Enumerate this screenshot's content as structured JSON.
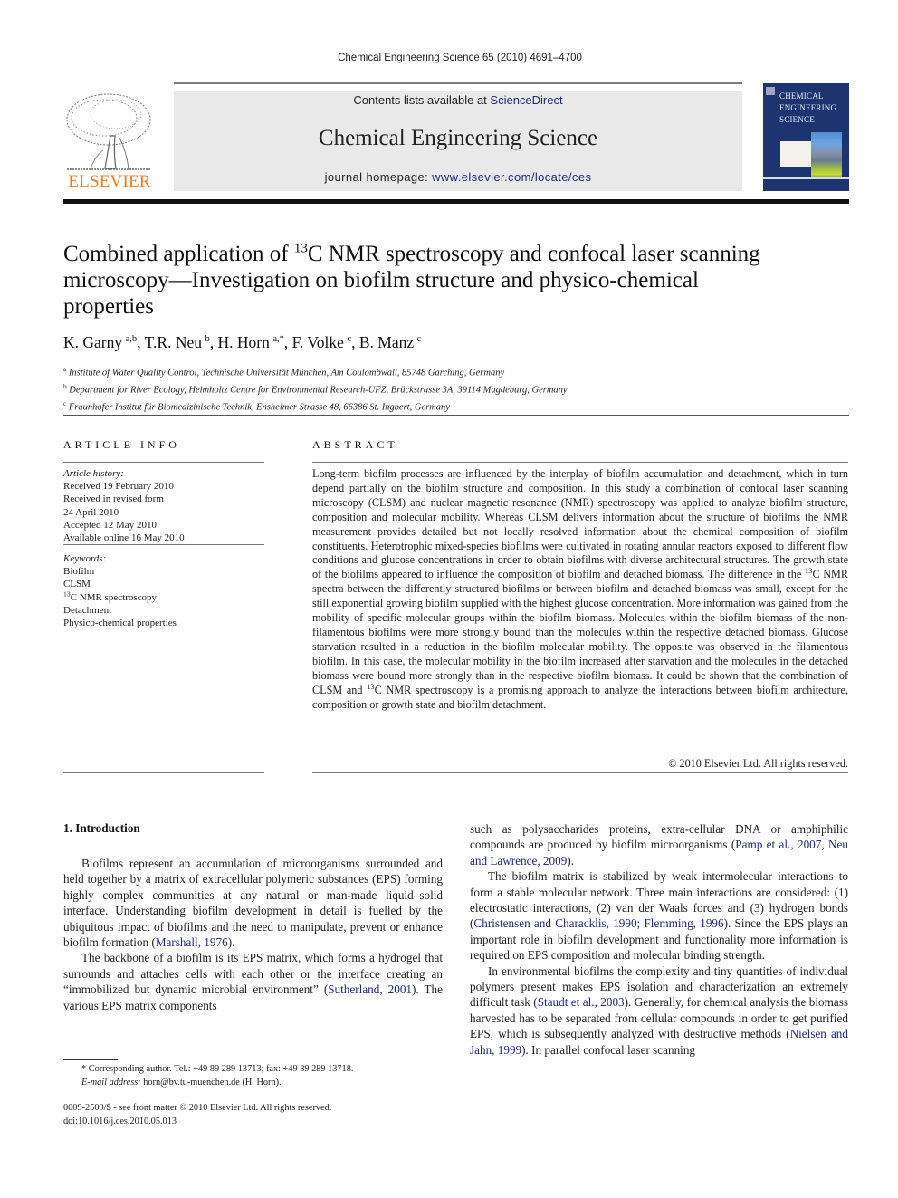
{
  "running_head": "Chemical Engineering Science 65 (2010) 4691–4700",
  "masthead": {
    "publisher_logo_text": "ELSEVIER",
    "contents_prefix": "Contents lists available at ",
    "contents_link": "ScienceDirect",
    "journal_name": "Chemical Engineering Science",
    "homepage_prefix": "journal homepage: ",
    "homepage_link": "www.elsevier.com/locate/ces",
    "cover_title_lines": [
      "CHEMICAL",
      "ENGINEERING",
      "SCIENCE"
    ],
    "colors": {
      "logo_orange": "#f07b1d",
      "link_blue": "#1f2a7a",
      "cover_blue": "#1d3470",
      "banner_gray": "#e9e9e9"
    }
  },
  "article": {
    "title_part1": "Combined application of ",
    "title_sup": "13",
    "title_part2": "C NMR spectroscopy and confocal laser scanning microscopy—Investigation on biofilm structure and physico-chemical properties",
    "authors": [
      {
        "name": "K. Garny",
        "sup": "a,b"
      },
      {
        "name": "T.R. Neu",
        "sup": "b"
      },
      {
        "name": "H. Horn",
        "sup": "a,*"
      },
      {
        "name": "F. Volke",
        "sup": "c"
      },
      {
        "name": "B. Manz",
        "sup": "c"
      }
    ],
    "affiliations": [
      {
        "key": "a",
        "text": "Institute of Water Quality Control, Technische Universität München, Am Coulombwall, 85748 Garching, Germany"
      },
      {
        "key": "b",
        "text": "Department for River Ecology, Helmholtz Centre for Environmental Research-UFZ, Brückstrasse 3A, 39114 Magdeburg, Germany"
      },
      {
        "key": "c",
        "text": "Fraunhofer Institut für Biomedizinische Technik, Ensheimer Strasse 48, 66386 St. Ingbert, Germany"
      }
    ]
  },
  "article_info": {
    "heading": "ARTICLE INFO",
    "history_label": "Article history:",
    "history": [
      "Received 19 February 2010",
      "Received in revised form",
      "24 April 2010",
      "Accepted 12 May 2010",
      "Available online 16 May 2010"
    ],
    "keywords_label": "Keywords:",
    "keywords": [
      "Biofilm",
      "CLSM",
      "13C NMR spectroscopy",
      "Detachment",
      "Physico-chemical properties"
    ],
    "keyword_nmr_sup": "13",
    "keyword_nmr_rest": "C NMR spectroscopy"
  },
  "abstract": {
    "heading": "ABSTRACT",
    "part1": "Long-term biofilm processes are influenced by the interplay of biofilm accumulation and detachment, which in turn depend partially on the biofilm structure and composition. In this study a combination of confocal laser scanning microscopy (CLSM) and nuclear magnetic resonance (NMR) spectroscopy was applied to analyze biofilm structure, composition and molecular mobility. Whereas CLSM delivers information about the structure of biofilms the NMR measurement provides detailed but not locally resolved information about the chemical composition of biofilm constituents. Heterotrophic mixed-species biofilms were cultivated in rotating annular reactors exposed to different flow conditions and glucose concentrations in order to obtain biofilms with diverse architectural structures. The growth state of the biofilms appeared to influence the composition of biofilm and detached biomass. The difference in the ",
    "sup1": "13",
    "part2": "C NMR spectra between the differently structured biofilms or between biofilm and detached biomass was small, except for the still exponential growing biofilm supplied with the highest glucose concentration. More information was gained from the mobility of specific molecular groups within the biofilm biomass. Molecules within the biofilm biomass of the non-filamentous biofilms were more strongly bound than the molecules within the respective detached biomass. Glucose starvation resulted in a reduction in the biofilm molecular mobility. The opposite was observed in the filamentous biofilm. In this case, the molecular mobility in the biofilm increased after starvation and the molecules in the detached biomass were bound more strongly than in the respective biofilm biomass. It could be shown that the combination of CLSM and ",
    "sup2": "13",
    "part3": "C NMR spectroscopy is a promising approach to analyze the interactions between biofilm architecture, composition or growth state and biofilm detachment.",
    "copyright": "© 2010 Elsevier Ltd. All rights reserved."
  },
  "body": {
    "section_heading": "1.  Introduction",
    "col1": {
      "p1_text": "Biofilms represent an accumulation of microorganisms surrounded and held together by a matrix of extracellular polymeric substances (EPS) forming highly complex communities at any natural or man-made liquid–solid interface. Understanding biofilm development in detail is fuelled by the ubiquitous impact of biofilms and the need to manipulate, prevent or enhance biofilm formation (",
      "p1_cite": "Marshall, 1976",
      "p1_end": ").",
      "p2_text": "The backbone of a biofilm is its EPS matrix, which forms a hydrogel that surrounds and attaches cells with each other or the interface creating an “immobilized but dynamic microbial environment” (",
      "p2_cite": "Sutherland, 2001",
      "p2_end": "). The various EPS matrix components"
    },
    "col2": {
      "p1_text": "such as polysaccharides proteins, extra-cellular DNA or amphiphilic compounds are produced by biofilm microorganisms (",
      "p1_cite": "Pamp et al., 2007, Neu and Lawrence, 2009",
      "p1_end": ").",
      "p2_text": "The biofilm matrix is stabilized by weak intermolecular interactions to form a stable molecular network. Three main interactions are considered: (1) electrostatic interactions, (2) van der Waals forces and (3) hydrogen bonds (",
      "p2_cite": "Christensen and Characklis, 1990; Flemming, 1996",
      "p2_end": "). Since the EPS plays an important role in biofilm development and functionality more information is required on EPS composition and molecular binding strength.",
      "p3_text": "In environmental biofilms the complexity and tiny quantities of individual polymers present makes EPS isolation and characterization an extremely difficult task (",
      "p3_cite": "Staudt et al., 2003",
      "p3_mid": "). Generally, for chemical analysis the biomass harvested has to be separated from cellular compounds in order to get purified EPS, which is subsequently analyzed with destructive methods (",
      "p3_cite2": "Nielsen and Jahn, 1999",
      "p3_end": "). In parallel confocal laser scanning"
    }
  },
  "footnotes": {
    "corresponding": "* Corresponding author. Tel.: +49 89 289 13713; fax: +49 89 289 13718.",
    "email_label": "E-mail address:",
    "email": " horn@bv.tu-muenchen.de (H. Horn).",
    "front_matter": "0009-2509/$ - see front matter © 2010 Elsevier Ltd. All rights reserved.",
    "doi": "doi:10.1016/j.ces.2010.05.013"
  }
}
